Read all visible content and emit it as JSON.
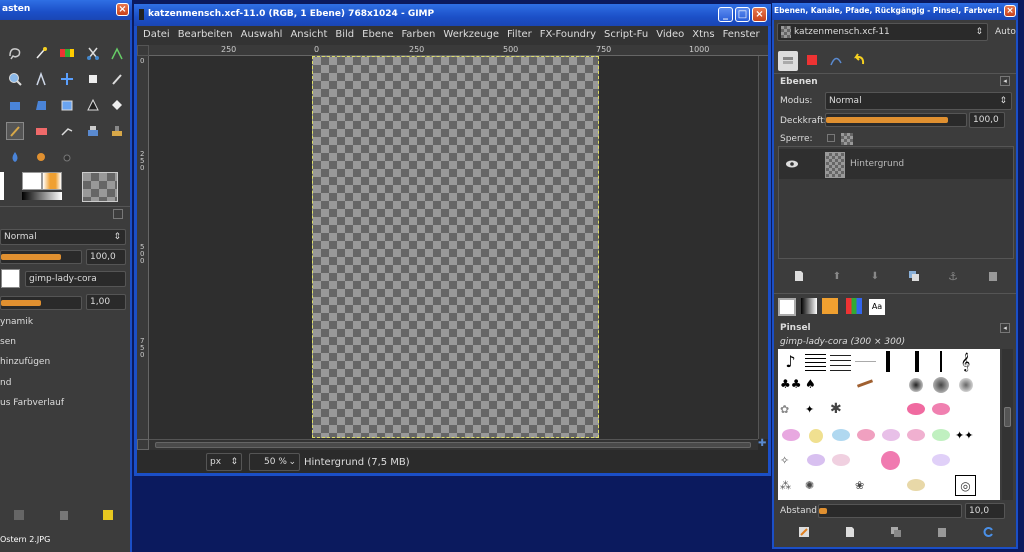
{
  "toolbox": {
    "title": "asten",
    "mode": "Normal",
    "opacity": "100,0",
    "brush_name": "gimp-lady-cora",
    "size": "1,00",
    "options": [
      "ynamik",
      "sen",
      "hinzufügen",
      "nd",
      "us Farbverlauf"
    ],
    "taskbar_label": "Ostern 2.JPG"
  },
  "image_window": {
    "title": "katzenmensch.xcf-11.0 (RGB, 1 Ebene) 768x1024 - GIMP",
    "menu": [
      "Datei",
      "Bearbeiten",
      "Auswahl",
      "Ansicht",
      "Bild",
      "Ebene",
      "Farben",
      "Werkzeuge",
      "Filter",
      "FX-Foundry",
      "Script-Fu",
      "Video",
      "Xtns",
      "Fenster"
    ],
    "ruler_marks": [
      "250",
      "0",
      "250",
      "500",
      "750",
      "1000"
    ],
    "vruler_marks": [
      "0",
      "2 5 0",
      "5 0 0",
      "7 5 0"
    ],
    "unit": "px",
    "zoom": "50 %",
    "status": "Hintergrund (7,5 MB)"
  },
  "layers_dock": {
    "title": "Ebenen, Kanäle, Pfade, Rückgängig - Pinsel, Farbverl...",
    "image_select": "katzenmensch.xcf-11",
    "auto_label": "Auto",
    "panel_title": "Ebenen",
    "mode_label": "Modus:",
    "mode_value": "Normal",
    "opacity_label": "Deckkraft:",
    "opacity_value": "100,0",
    "lock_label": "Sperre:",
    "layer_name": "Hintergrund",
    "brushes_title": "Pinsel",
    "brush_info": "gimp-lady-cora (300 × 300)",
    "spacing_label": "Abstand:",
    "spacing_value": "10,0",
    "font_tab": "Aa"
  }
}
